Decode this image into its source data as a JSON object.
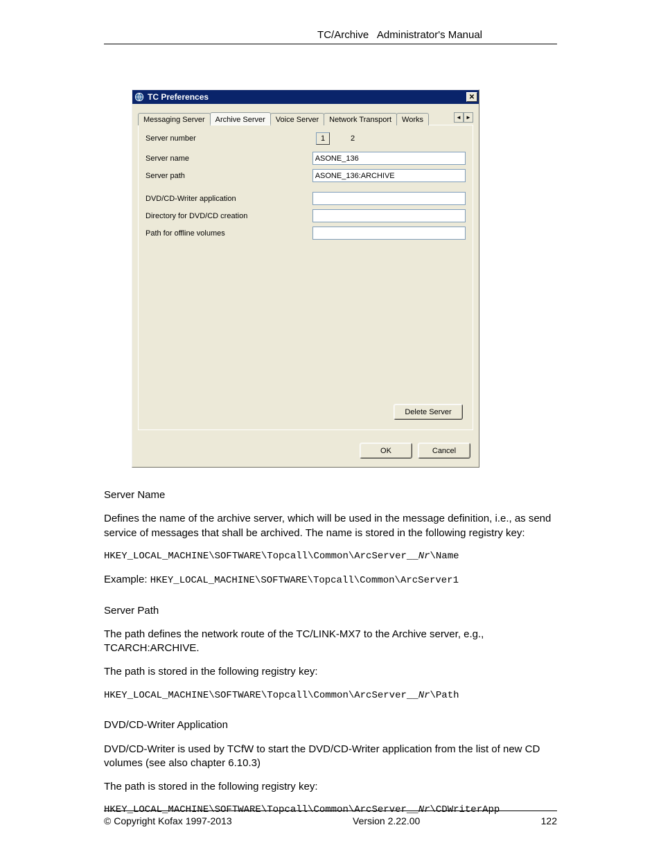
{
  "header": {
    "page_title_left": "TC/Archive",
    "page_title_right": "Administrator's Manual"
  },
  "dialog": {
    "title": "TC Preferences",
    "close_glyph": "✕",
    "tabs": {
      "messaging": "Messaging Server",
      "archive": "Archive Server",
      "voice": "Voice Server",
      "network": "Network Transport",
      "works": "Works"
    },
    "scroll_left": "◄",
    "scroll_right": "►",
    "fields": {
      "server_number_label": "Server number",
      "server_number_box": "1",
      "server_number_2": "2",
      "server_name_label": "Server name",
      "server_name_value": "ASONE_136",
      "server_path_label": "Server path",
      "server_path_value": "ASONE_136:ARCHIVE",
      "dvdcd_app_label": "DVD/CD-Writer application",
      "dvdcd_app_value": "",
      "dvdcd_dir_label": "Directory for DVD/CD creation",
      "dvdcd_dir_value": "",
      "offline_label": "Path for offline volumes",
      "offline_value": ""
    },
    "buttons": {
      "delete": "Delete Server",
      "ok": "OK",
      "cancel": "Cancel"
    }
  },
  "body": {
    "server_name_heading": "Server Name",
    "server_name_text": "Defines the name of the archive server, which will be used in the message definition, i.e., as send service of messages that shall be archived. The name is stored in the following registry key:",
    "reg_name_pre": "HKEY_LOCAL_MACHINE\\SOFTWARE\\Topcall\\Common\\ArcServer__",
    "reg_name_var": "Nr",
    "reg_name_post": "\\Name",
    "example_label": "Example: ",
    "example_reg": "HKEY_LOCAL_MACHINE\\SOFTWARE\\Topcall\\Common\\ArcServer1",
    "server_path_heading": "Server Path",
    "server_path_text1": "The path defines the network route of the TC/LINK-MX7 to the Archive server, e.g., TCARCH:ARCHIVE.",
    "server_path_text2": "The path is stored in the following registry key:",
    "reg_path_pre": "HKEY_LOCAL_MACHINE\\SOFTWARE\\Topcall\\Common\\ArcServer__",
    "reg_path_var": "Nr",
    "reg_path_post": "\\Path",
    "dvd_heading": "DVD/CD-Writer Application",
    "dvd_text1": "DVD/CD-Writer is used by TCfW to start the DVD/CD-Writer application from the list of new CD volumes (see also chapter 6.10.3)",
    "dvd_text2": "The path is stored in the following registry key:",
    "reg_cd_pre": "HKEY_LOCAL_MACHINE\\SOFTWARE\\Topcall\\Common\\ArcServer__",
    "reg_cd_var": "Nr",
    "reg_cd_post": "\\CDWriterApp"
  },
  "footer": {
    "copyright": "© Copyright Kofax 1997-2013",
    "version": "Version 2.22.00",
    "page": "122"
  }
}
